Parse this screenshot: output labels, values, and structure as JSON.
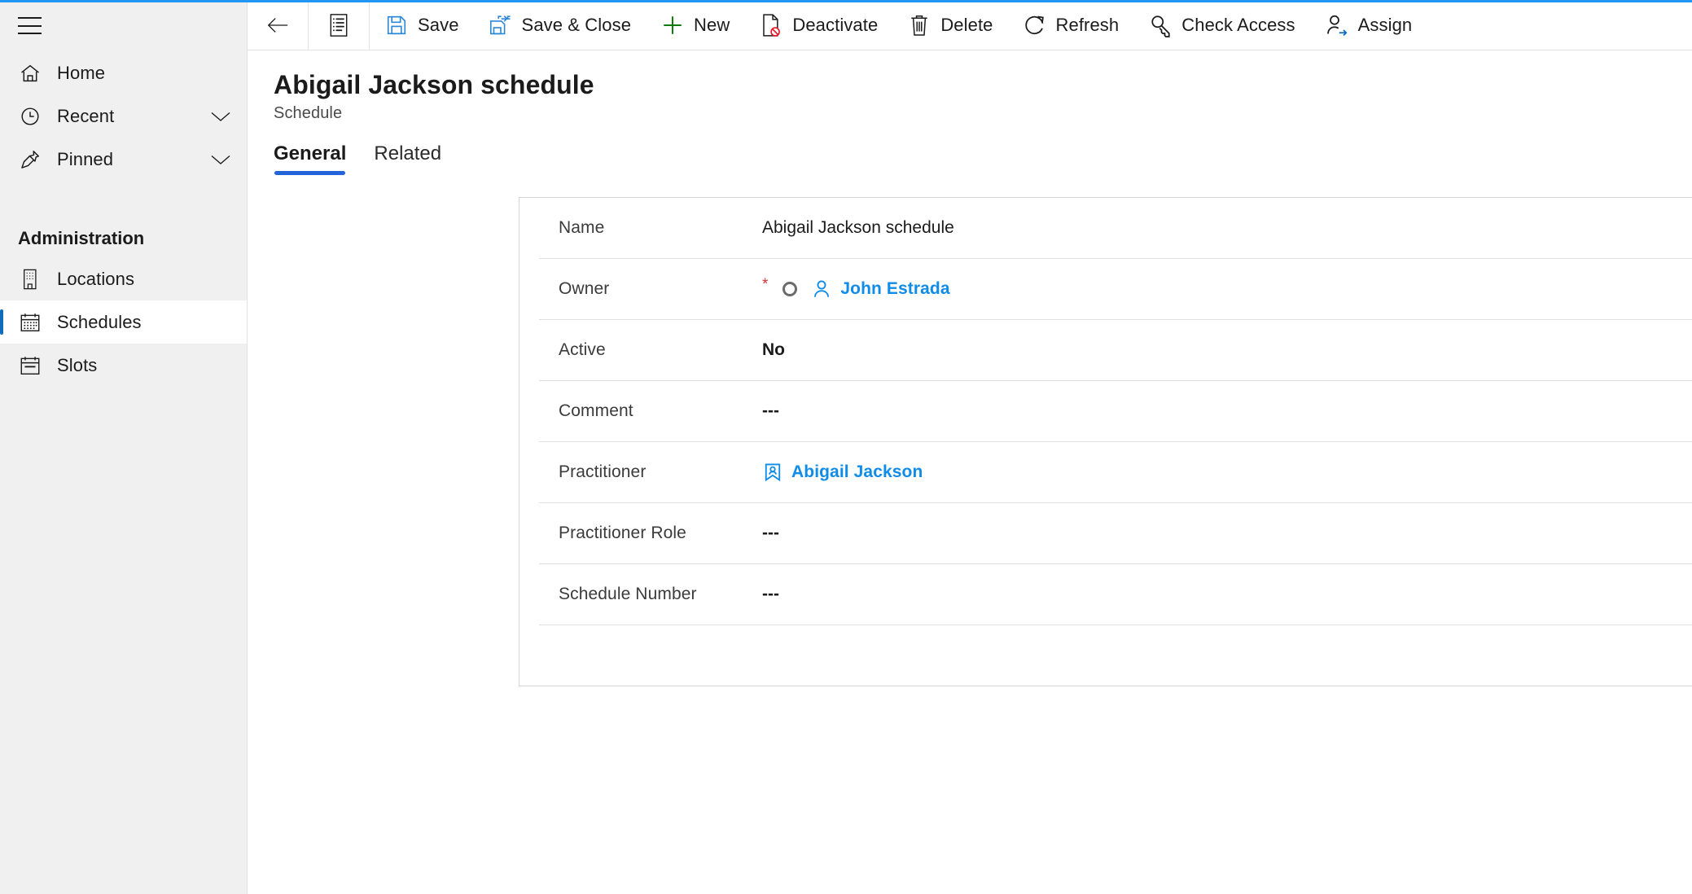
{
  "colors": {
    "accent": "#2196f3",
    "link": "#0f8ce8",
    "tab_underline": "#2364d8",
    "selected_indicator": "#0f6cbd",
    "required": "#d13438",
    "sidebar_bg": "#f0f0f0",
    "new_icon": "#0f7b0f",
    "save_icon": "#2b88d8",
    "deactivate_mark": "#e81123"
  },
  "sidebar": {
    "menu_button": "site-map-menu",
    "items": [
      {
        "label": "Home",
        "icon": "home-icon",
        "chevron": false,
        "selected": false
      },
      {
        "label": "Recent",
        "icon": "clock-icon",
        "chevron": true,
        "selected": false
      },
      {
        "label": "Pinned",
        "icon": "pin-icon",
        "chevron": true,
        "selected": false
      }
    ],
    "section_title": "Administration",
    "section_items": [
      {
        "label": "Locations",
        "icon": "building-icon",
        "selected": false
      },
      {
        "label": "Schedules",
        "icon": "calendar-grid-icon",
        "selected": true
      },
      {
        "label": "Slots",
        "icon": "calendar-day-icon",
        "selected": false
      }
    ]
  },
  "commandbar": {
    "back_label": "",
    "items": [
      {
        "label": "",
        "icon": "form-selector-icon",
        "type": "icon"
      },
      {
        "label": "Save",
        "icon": "save-icon",
        "type": "button"
      },
      {
        "label": "Save & Close",
        "icon": "save-and-close-icon",
        "type": "button"
      },
      {
        "label": "New",
        "icon": "plus-icon",
        "type": "button"
      },
      {
        "label": "Deactivate",
        "icon": "deactivate-icon",
        "type": "button"
      },
      {
        "label": "Delete",
        "icon": "trash-icon",
        "type": "button"
      },
      {
        "label": "Refresh",
        "icon": "refresh-icon",
        "type": "button"
      },
      {
        "label": "Check Access",
        "icon": "key-icon",
        "type": "button"
      },
      {
        "label": "Assign",
        "icon": "assign-user-icon",
        "type": "button"
      }
    ]
  },
  "record": {
    "title": "Abigail Jackson schedule",
    "subtitle": "Schedule"
  },
  "tabs": [
    {
      "label": "General",
      "active": true
    },
    {
      "label": "Related",
      "active": false
    }
  ],
  "form": {
    "fields": [
      {
        "label": "Name",
        "value": "Abigail Jackson schedule",
        "kind": "text",
        "required": false
      },
      {
        "label": "Owner",
        "value": "John Estrada",
        "kind": "lookup-user",
        "required": true
      },
      {
        "label": "Active",
        "value": "No",
        "kind": "bold",
        "required": false
      },
      {
        "label": "Comment",
        "value": "---",
        "kind": "empty",
        "required": false
      },
      {
        "label": "Practitioner",
        "value": "Abigail Jackson",
        "kind": "lookup-contact",
        "required": false
      },
      {
        "label": "Practitioner Role",
        "value": "---",
        "kind": "empty",
        "required": false
      },
      {
        "label": "Schedule Number",
        "value": "---",
        "kind": "empty",
        "required": false
      }
    ]
  }
}
